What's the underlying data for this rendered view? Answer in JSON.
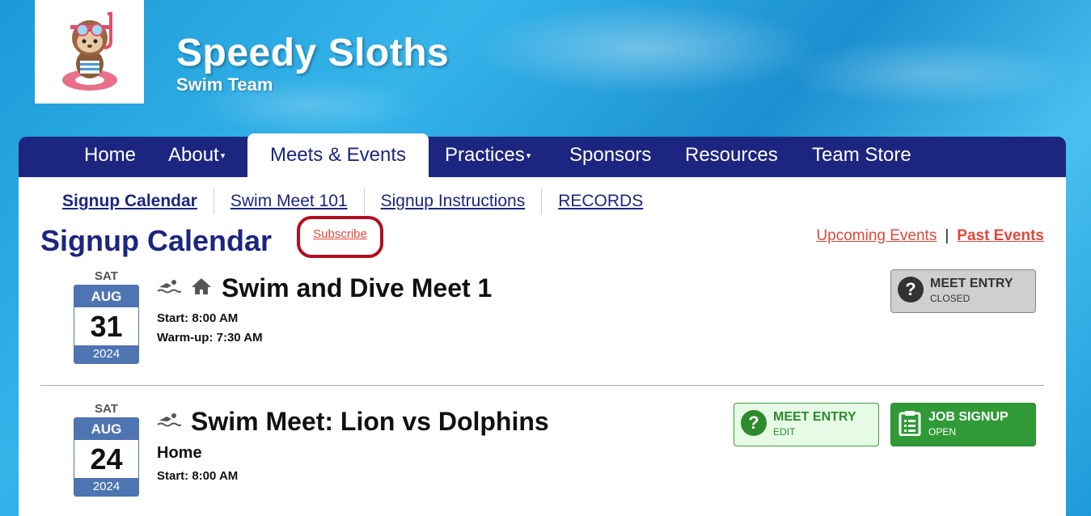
{
  "header": {
    "team_name": "Speedy Sloths",
    "subtitle": "Swim Team"
  },
  "nav": {
    "items": [
      {
        "label": "Home"
      },
      {
        "label": "About"
      },
      {
        "label": "Meets & Events"
      },
      {
        "label": "Practices"
      },
      {
        "label": "Sponsors"
      },
      {
        "label": "Resources"
      },
      {
        "label": "Team Store"
      }
    ],
    "dropdown_caret": "▾"
  },
  "subnav": {
    "items": [
      "Signup Calendar",
      "Swim Meet 101",
      "Signup Instructions",
      "RECORDS"
    ]
  },
  "page": {
    "title": "Signup Calendar",
    "subscribe": "Subscribe",
    "upcoming": "Upcoming Events",
    "separator": "|",
    "past": "Past Events"
  },
  "events": [
    {
      "dow": "SAT",
      "month": "AUG",
      "day": "31",
      "year": "2024",
      "title": "Swim and Dive Meet 1",
      "icons": [
        "swimmer-icon",
        "home-icon"
      ],
      "lines": [
        "Start: 8:00 AM",
        "Warm-up: 7:30 AM"
      ],
      "buttons": [
        {
          "label": "MEET ENTRY",
          "status": "CLOSED",
          "icon": "question-icon",
          "color": "#cfcfcf"
        }
      ]
    },
    {
      "dow": "SAT",
      "month": "AUG",
      "day": "24",
      "year": "2024",
      "title": "Swim Meet: Lion vs Dolphins",
      "icons": [
        "swimmer-icon"
      ],
      "location": "Home",
      "lines": [
        "Start: 8:00 AM"
      ],
      "buttons": [
        {
          "label": "MEET ENTRY",
          "status": "EDIT",
          "icon": "question-icon",
          "color": "#e6fbe6"
        },
        {
          "label": "JOB SIGNUP",
          "status": "OPEN",
          "icon": "clipboard-icon",
          "color": "#2f9a36"
        }
      ]
    }
  ],
  "colors": {
    "navy": "#1c2680",
    "link_red": "#e1483a",
    "date_blue": "#4e74b2",
    "highlight_ring": "#b20f1e"
  }
}
